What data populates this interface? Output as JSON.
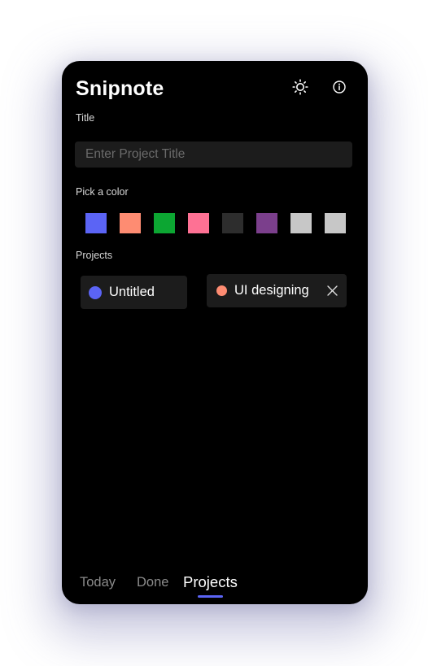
{
  "app": {
    "title": "Snipnote"
  },
  "header": {
    "theme_icon": "sun-icon",
    "info_icon": "info-icon"
  },
  "form": {
    "title_label": "Title",
    "title_placeholder": "Enter Project Title",
    "title_value": "",
    "color_label": "Pick a color"
  },
  "colors": [
    "#5b64f5",
    "#fe8c72",
    "#0ca632",
    "#fe7194",
    "#2d2d2d",
    "#7b3f8c",
    "#c7c7c7",
    "#c7c7c7"
  ],
  "projects": {
    "label": "Projects",
    "items": [
      {
        "name": "Untitled",
        "color": "#5b64f5",
        "removable": false
      },
      {
        "name": "UI designing",
        "color": "#fe8c72",
        "removable": true,
        "remove_icon": "close-icon"
      }
    ]
  },
  "tabs": {
    "items": [
      "Today",
      "Done",
      "Projects"
    ],
    "active": "Projects",
    "indicator_color": "#5b64f5"
  }
}
